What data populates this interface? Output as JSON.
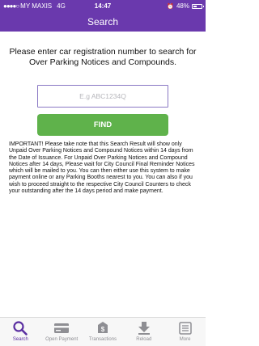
{
  "status_bar": {
    "carrier": "MY MAXIS",
    "network": "4G",
    "time": "14:47",
    "battery": "48%",
    "battery_level": 0.48
  },
  "nav": {
    "title": "Search"
  },
  "prompt": "Please enter car registration number to search for Over Parking Notices and Compounds.",
  "search": {
    "placeholder": "E.g ABC1234Q",
    "value": ""
  },
  "find_button": "FIND",
  "notice": "IMPORTANT! Please take note that this Search Result will show only Unpaid Over Parking Notices and Compound Notices within 14 days from the Date of Issuance. For Unpaid Over Parking Notices and Compound Notices after 14 days, Please wait for City Council Final Reminder Notices which will be mailed to you. You can then either use this system to make payment online or any Parking Booths nearest to you. You can also if you wish to proceed straight to the respective City Council Counters to check your outstanding after the 14 days period and make payment.",
  "tabs": [
    {
      "label": "Search",
      "icon": "search-icon",
      "active": true
    },
    {
      "label": "Open Payment",
      "icon": "card-icon",
      "active": false
    },
    {
      "label": "Transactions",
      "icon": "transactions-icon",
      "active": false
    },
    {
      "label": "Reload",
      "icon": "reload-icon",
      "active": false
    },
    {
      "label": "More",
      "icon": "more-icon",
      "active": false
    }
  ],
  "colors": {
    "primary": "#6a39ad",
    "accent": "#5fb24b",
    "tab_active": "#5a2fa1",
    "tab_inactive": "#8e8e93"
  }
}
